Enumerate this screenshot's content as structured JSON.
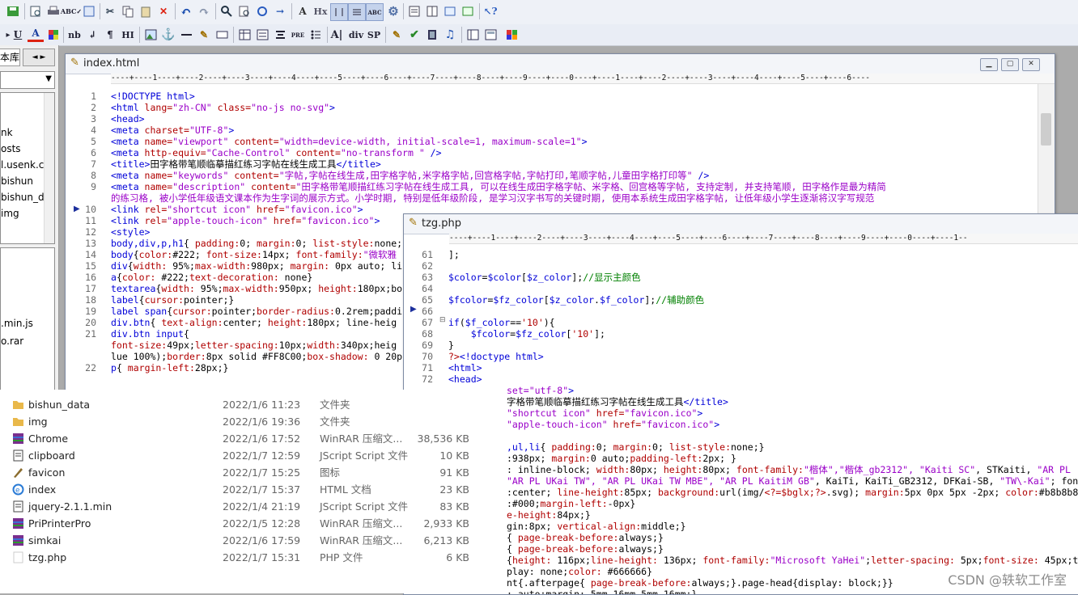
{
  "toolbar2": {
    "labels": [
      "U",
      "A",
      "nb",
      "¶",
      "HI",
      "PRE",
      "div",
      "SP"
    ]
  },
  "leftpanel": {
    "tab_label": "本库",
    "tab_arrows": [
      "◄",
      "►"
    ],
    "items": [
      "nk",
      "osts",
      "l.usenk.c",
      "bishun",
      "bishun_d",
      "img"
    ],
    "items2": [
      ".min.js",
      "o.rar"
    ]
  },
  "win1": {
    "title": "index.html",
    "ruler": "----+----1----+----2----+----3----+----4----+----5----+----6----+----7----+----8----+----9----+----0----+----1----+----2----+----3----+----4----+----5----+----6----",
    "gutter": [
      "1",
      "2",
      "3",
      "4",
      "5",
      "6",
      "7",
      "8",
      "9",
      "",
      "10",
      "11",
      "12",
      "13",
      "14",
      "15",
      "16",
      "17",
      "18",
      "19",
      "20",
      "21",
      "",
      "",
      "22"
    ],
    "lines": [
      [
        [
          "tag",
          "<!DOCTYPE html>"
        ]
      ],
      [
        [
          "tag",
          "<html "
        ],
        [
          "attr",
          "lang="
        ],
        [
          "str",
          "\"zh-CN\""
        ],
        [
          "attr",
          " class="
        ],
        [
          "str",
          "\"no-js no-svg\""
        ],
        [
          "tag",
          ">"
        ]
      ],
      [
        [
          "tag",
          "<head>"
        ]
      ],
      [
        [
          "tag",
          "<meta "
        ],
        [
          "attr",
          "charset="
        ],
        [
          "str",
          "\"UTF-8\""
        ],
        [
          "tag",
          ">"
        ]
      ],
      [
        [
          "tag",
          "<meta "
        ],
        [
          "attr",
          "name="
        ],
        [
          "str",
          "\"viewport\""
        ],
        [
          "attr",
          " content="
        ],
        [
          "str",
          "\"width=device-width, initial-scale=1, maximum-scale=1\""
        ],
        [
          "tag",
          ">"
        ]
      ],
      [
        [
          "tag",
          "<meta "
        ],
        [
          "attr",
          "http-equiv="
        ],
        [
          "str",
          "\"Cache-Control\""
        ],
        [
          "attr",
          " content="
        ],
        [
          "str",
          "\"no-transform \""
        ],
        [
          "tag",
          " />"
        ]
      ],
      [
        [
          "tag",
          "<title>"
        ],
        [
          "txt",
          "田字格带笔顺临摹描红练习字帖在线生成工具"
        ],
        [
          "tag",
          "</title>"
        ]
      ],
      [
        [
          "tag",
          "<meta "
        ],
        [
          "attr",
          "name="
        ],
        [
          "str",
          "\"keywords\""
        ],
        [
          "attr",
          " content="
        ],
        [
          "str",
          "\"字帖,字帖在线生成,田字格字帖,米字格字帖,回宫格字帖,字帖打印,笔顺字帖,儿童田字格打印等\""
        ],
        [
          "tag",
          " />"
        ]
      ],
      [
        [
          "tag",
          "<meta "
        ],
        [
          "attr",
          "name="
        ],
        [
          "str",
          "\"description\""
        ],
        [
          "attr",
          " content="
        ],
        [
          "str",
          "\"田字格带笔顺描红练习字帖在线生成工具, 可以在线生成田字格字帖、米字格、回宫格等字帖, 支持定制, 并支持笔顺, 田字格作是最为精简"
        ]
      ],
      [
        [
          "str",
          "的练习格, 被小学低年级语文课本作为生字词的展示方式。小学时期, 特别是低年级阶段, 是学习汉字书写的关键时期, 使用本系统生成田字格字帖, 让低年级小学生逐渐将汉字写规范"
        ]
      ],
      [
        [
          "tag",
          "<link "
        ],
        [
          "attr",
          "rel="
        ],
        [
          "str",
          "\"shortcut icon\""
        ],
        [
          "attr",
          " href="
        ],
        [
          "str",
          "\"favicon.ico\""
        ],
        [
          "tag",
          ">"
        ]
      ],
      [
        [
          "tag",
          "<link "
        ],
        [
          "attr",
          "rel="
        ],
        [
          "str",
          "\"apple-touch-icon\""
        ],
        [
          "attr",
          " href="
        ],
        [
          "str",
          "\"favicon.ico\""
        ],
        [
          "tag",
          ">"
        ]
      ],
      [
        [
          "tag",
          "<style>"
        ]
      ],
      [
        [
          "kw",
          "body,div,p,h1"
        ],
        [
          "txt",
          "{ "
        ],
        [
          "attr",
          "padding:"
        ],
        [
          "txt",
          "0; "
        ],
        [
          "attr",
          "margin:"
        ],
        [
          "txt",
          "0; "
        ],
        [
          "attr",
          "list-style:"
        ],
        [
          "txt",
          "none;"
        ]
      ],
      [
        [
          "kw",
          "body"
        ],
        [
          "txt",
          "{"
        ],
        [
          "attr",
          "color:"
        ],
        [
          "txt",
          "#222; "
        ],
        [
          "attr",
          "font-size:"
        ],
        [
          "txt",
          "14px; "
        ],
        [
          "attr",
          "font-family:"
        ],
        [
          "str",
          "\"微软雅"
        ]
      ],
      [
        [
          "kw",
          "div"
        ],
        [
          "txt",
          "{"
        ],
        [
          "attr",
          "width:"
        ],
        [
          "txt",
          " 95%;"
        ],
        [
          "attr",
          "max-width:"
        ],
        [
          "txt",
          "980px; "
        ],
        [
          "attr",
          "margin:"
        ],
        [
          "txt",
          " 0px auto; li"
        ]
      ],
      [
        [
          "kw",
          "a"
        ],
        [
          "txt",
          "{"
        ],
        [
          "attr",
          "color:"
        ],
        [
          "txt",
          " #222;"
        ],
        [
          "attr",
          "text-decoration:"
        ],
        [
          "txt",
          " none}"
        ]
      ],
      [
        [
          "kw",
          "textarea"
        ],
        [
          "txt",
          "{"
        ],
        [
          "attr",
          "width:"
        ],
        [
          "txt",
          " 95%;"
        ],
        [
          "attr",
          "max-width:"
        ],
        [
          "txt",
          "950px; "
        ],
        [
          "attr",
          "height:"
        ],
        [
          "txt",
          "180px;bo"
        ]
      ],
      [
        [
          "kw",
          "label"
        ],
        [
          "txt",
          "{"
        ],
        [
          "attr",
          "cursor:"
        ],
        [
          "txt",
          "pointer;}"
        ]
      ],
      [
        [
          "kw",
          "label span"
        ],
        [
          "txt",
          "{"
        ],
        [
          "attr",
          "cursor:"
        ],
        [
          "txt",
          "pointer;"
        ],
        [
          "attr",
          "border-radius:"
        ],
        [
          "txt",
          "0.2rem;paddi"
        ]
      ],
      [
        [
          "kw",
          "div.btn"
        ],
        [
          "txt",
          "{ "
        ],
        [
          "attr",
          "text-align:"
        ],
        [
          "txt",
          "center; "
        ],
        [
          "attr",
          "height:"
        ],
        [
          "txt",
          "180px; line-heig"
        ]
      ],
      [
        [
          "kw",
          "div.btn input"
        ],
        [
          "txt",
          "{"
        ]
      ],
      [
        [
          "attr",
          "font-size:"
        ],
        [
          "txt",
          "49px;"
        ],
        [
          "attr",
          "letter-spacing:"
        ],
        [
          "txt",
          "10px;"
        ],
        [
          "attr",
          "width:"
        ],
        [
          "txt",
          "340px;heig"
        ]
      ],
      [
        [
          "txt",
          "lue 100%);"
        ],
        [
          "attr",
          "border:"
        ],
        [
          "txt",
          "8px solid #FF8C00;"
        ],
        [
          "attr",
          "box-shadow:"
        ],
        [
          "txt",
          " 0 20p"
        ]
      ],
      [
        [
          "kw",
          "p"
        ],
        [
          "txt",
          "{ "
        ],
        [
          "attr",
          "margin-left:"
        ],
        [
          "txt",
          "28px;}"
        ]
      ]
    ]
  },
  "win2": {
    "title": "tzg.php",
    "ruler": "----+----1----+----2----+----3----+----4----+----5----+----6----+----7----+----8----+----9----+----0----+----1--",
    "gutter": [
      "61",
      "62",
      "63",
      "64",
      "65",
      "66",
      "67",
      "68",
      "69",
      "70",
      "71",
      "72"
    ],
    "lines": [
      [
        [
          "txt",
          "];"
        ]
      ],
      [
        [
          "txt",
          ""
        ]
      ],
      [
        [
          "var",
          "$color"
        ],
        [
          "txt",
          "="
        ],
        [
          "var",
          "$color"
        ],
        [
          "txt",
          "["
        ],
        [
          "var",
          "$z_color"
        ],
        [
          "txt",
          "];"
        ],
        [
          "cmt",
          "//显示主颜色"
        ]
      ],
      [
        [
          "txt",
          ""
        ]
      ],
      [
        [
          "var",
          "$fcolor"
        ],
        [
          "txt",
          "="
        ],
        [
          "var",
          "$fz_color"
        ],
        [
          "txt",
          "["
        ],
        [
          "var",
          "$z_color"
        ],
        [
          "txt",
          "."
        ],
        [
          "var",
          "$f_color"
        ],
        [
          "txt",
          "];"
        ],
        [
          "cmt",
          "//辅助颜色"
        ]
      ],
      [
        [
          "txt",
          ""
        ]
      ],
      [
        [
          "kw",
          "if"
        ],
        [
          "txt",
          "("
        ],
        [
          "var",
          "$f_color"
        ],
        [
          "txt",
          "=="
        ],
        [
          "php",
          "'10'"
        ],
        [
          "txt",
          "){"
        ]
      ],
      [
        [
          "txt",
          "    "
        ],
        [
          "var",
          "$fcolor"
        ],
        [
          "txt",
          "="
        ],
        [
          "var",
          "$fz_color"
        ],
        [
          "txt",
          "["
        ],
        [
          "php",
          "'10'"
        ],
        [
          "txt",
          "];"
        ]
      ],
      [
        [
          "txt",
          "}"
        ]
      ],
      [
        [
          "php",
          "?>"
        ],
        [
          "tag",
          "<!doctype html>"
        ]
      ],
      [
        [
          "tag",
          "<html>"
        ]
      ],
      [
        [
          "tag",
          "<head>"
        ]
      ]
    ],
    "overflow_lines": [
      [
        [
          "str",
          "set=\"utf-8\""
        ],
        [
          "tag",
          ">"
        ]
      ],
      [
        [
          "txt",
          "字格带笔顺临摹描红练习字帖在线生成工具"
        ],
        [
          "tag",
          "</title>"
        ]
      ],
      [
        [
          "str",
          "\"shortcut icon\""
        ],
        [
          "attr",
          " href="
        ],
        [
          "str",
          "\"favicon.ico\""
        ],
        [
          "tag",
          ">"
        ]
      ],
      [
        [
          "str",
          "\"apple-touch-icon\""
        ],
        [
          "attr",
          " href="
        ],
        [
          "str",
          "\"favicon.ico\""
        ],
        [
          "tag",
          ">"
        ]
      ],
      [
        [
          "txt",
          ""
        ]
      ],
      [
        [
          "kw",
          ",ul,li"
        ],
        [
          "txt",
          "{ "
        ],
        [
          "attr",
          "padding:"
        ],
        [
          "txt",
          "0; "
        ],
        [
          "attr",
          "margin:"
        ],
        [
          "txt",
          "0; "
        ],
        [
          "attr",
          "list-style:"
        ],
        [
          "txt",
          "none;}"
        ]
      ],
      [
        [
          "txt",
          ":938px; "
        ],
        [
          "attr",
          "margin:"
        ],
        [
          "txt",
          "0 auto;"
        ],
        [
          "attr",
          "padding-left:"
        ],
        [
          "txt",
          "2px; }"
        ]
      ],
      [
        [
          "txt",
          ": inline-block; "
        ],
        [
          "attr",
          "width:"
        ],
        [
          "txt",
          "80px; "
        ],
        [
          "attr",
          "height:"
        ],
        [
          "txt",
          "80px; "
        ],
        [
          "attr",
          "font-family:"
        ],
        [
          "str",
          "\"楷体\",\"楷体_gb2312\", \"Kaiti SC\""
        ],
        [
          "txt",
          ", STKaiti, "
        ],
        [
          "str",
          "\"AR PL"
        ]
      ],
      [
        [
          "str",
          "\"AR PL UKai TW\", \"AR PL UKai TW MBE\", \"AR PL KaitiM GB\""
        ],
        [
          "txt",
          ", KaiTi, KaiTi_GB2312, DFKai-SB, "
        ],
        [
          "str",
          "\"TW\\-Kai\""
        ],
        [
          "txt",
          "; fon"
        ]
      ],
      [
        [
          "txt",
          ":center; "
        ],
        [
          "attr",
          "line-height:"
        ],
        [
          "txt",
          "85px; "
        ],
        [
          "attr",
          "background:"
        ],
        [
          "txt",
          "url(img/"
        ],
        [
          "php",
          "<?=$bglx;?>"
        ],
        [
          "txt",
          ".svg); "
        ],
        [
          "attr",
          "margin:"
        ],
        [
          "txt",
          "5px 0px 5px -2px; "
        ],
        [
          "attr",
          "color:"
        ],
        [
          "txt",
          "#b8b8b8"
        ]
      ],
      [
        [
          "txt",
          ":#000;"
        ],
        [
          "attr",
          "margin-left:"
        ],
        [
          "txt",
          "-0px}"
        ]
      ],
      [
        [
          "attr",
          "e-height:"
        ],
        [
          "txt",
          "84px;}"
        ]
      ],
      [
        [
          "txt",
          "gin:8px; "
        ],
        [
          "attr",
          "vertical-align:"
        ],
        [
          "txt",
          "middle;}"
        ]
      ],
      [
        [
          "txt",
          "{ "
        ],
        [
          "attr",
          "page-break-before:"
        ],
        [
          "txt",
          "always;}"
        ]
      ],
      [
        [
          "txt",
          "{ "
        ],
        [
          "attr",
          "page-break-before:"
        ],
        [
          "txt",
          "always;}"
        ]
      ],
      [
        [
          "txt",
          "{"
        ],
        [
          "attr",
          "height:"
        ],
        [
          "txt",
          " 116px;"
        ],
        [
          "attr",
          "line-height:"
        ],
        [
          "txt",
          " 136px; "
        ],
        [
          "attr",
          "font-family:"
        ],
        [
          "str",
          "\"Microsoft YaHei\""
        ],
        [
          "txt",
          ";"
        ],
        [
          "attr",
          "letter-spacing:"
        ],
        [
          "txt",
          " 5px;"
        ],
        [
          "attr",
          "font-size:"
        ],
        [
          "txt",
          " 45px;t"
        ]
      ],
      [
        [
          "txt",
          "play: none;"
        ],
        [
          "attr",
          "color:"
        ],
        [
          "txt",
          " #666666}"
        ]
      ],
      [
        [
          "txt",
          "nt{.afterpage{ "
        ],
        [
          "attr",
          "page-break-before:"
        ],
        [
          "txt",
          "always;}.page-head{display: block;}}"
        ]
      ],
      [
        [
          "txt",
          ": auto;margin: 5mm 16mm 5mm 16mm;}"
        ]
      ]
    ]
  },
  "explorer": {
    "files": [
      {
        "name": "bishun_data",
        "date": "2022/1/6 11:23",
        "type": "文件夹",
        "size": "",
        "icon": "folder-icon",
        "color": "#e9b84a"
      },
      {
        "name": "img",
        "date": "2022/1/6 19:36",
        "type": "文件夹",
        "size": "",
        "icon": "folder-icon",
        "color": "#e9b84a"
      },
      {
        "name": "Chrome",
        "date": "2022/1/6 17:52",
        "type": "WinRAR 压缩文...",
        "size": "38,536 KB",
        "icon": "winrar-icon",
        "color": "#7a2f8f"
      },
      {
        "name": "clipboard",
        "date": "2022/1/7 12:59",
        "type": "JScript Script 文件",
        "size": "10 KB",
        "icon": "script-icon",
        "color": "#444444"
      },
      {
        "name": "favicon",
        "date": "2022/1/7 15:25",
        "type": "图标",
        "size": "91 KB",
        "icon": "favicon-icon",
        "color": "#8b6d2f"
      },
      {
        "name": "index",
        "date": "2022/1/7 15:37",
        "type": "HTML 文档",
        "size": "23 KB",
        "icon": "ie-icon",
        "color": "#2a7bd6"
      },
      {
        "name": "jquery-2.1.1.min",
        "date": "2022/1/4 21:19",
        "type": "JScript Script 文件",
        "size": "83 KB",
        "icon": "script-icon",
        "color": "#444444"
      },
      {
        "name": "PriPrinterPro",
        "date": "2022/1/5 12:28",
        "type": "WinRAR 压缩文...",
        "size": "2,933 KB",
        "icon": "winrar-icon",
        "color": "#7a2f8f"
      },
      {
        "name": "simkai",
        "date": "2022/1/6 17:59",
        "type": "WinRAR 压缩文...",
        "size": "6,213 KB",
        "icon": "winrar-icon",
        "color": "#7a2f8f"
      },
      {
        "name": "tzg.php",
        "date": "2022/1/7 15:31",
        "type": "PHP 文件",
        "size": "6 KB",
        "icon": "file-icon",
        "color": "#cccccc"
      }
    ]
  },
  "watermark": "CSDN @轶软工作室"
}
